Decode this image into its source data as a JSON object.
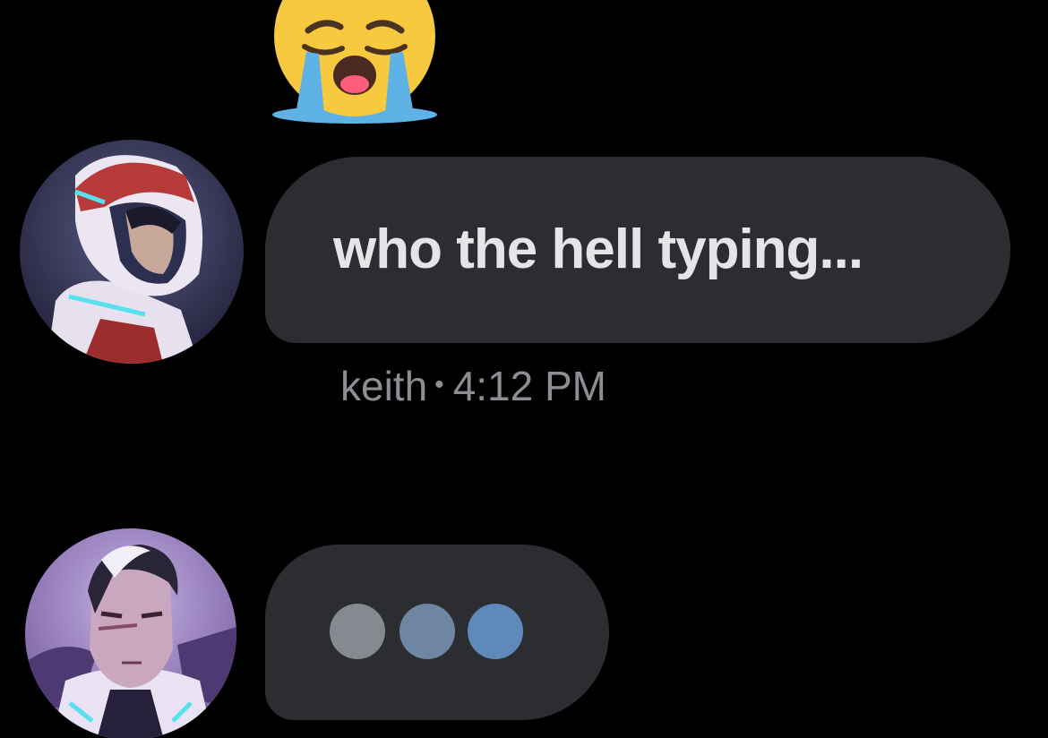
{
  "reaction": {
    "icon": "loudly-crying-face-icon"
  },
  "messages": [
    {
      "author": "keith",
      "text": "who the hell typing...",
      "meta": {
        "author": "keith",
        "separator": "•",
        "time": "4:12 PM"
      },
      "avatar": "keith-avatar"
    }
  ],
  "typing": {
    "avatar": "shiro-avatar",
    "dots": [
      "#858a91",
      "#6e86a1",
      "#5f89b8"
    ]
  },
  "colors": {
    "background": "#000000",
    "bubble": "#2b2d31",
    "text": "#e4e5e7",
    "meta": "#8b8e93"
  }
}
